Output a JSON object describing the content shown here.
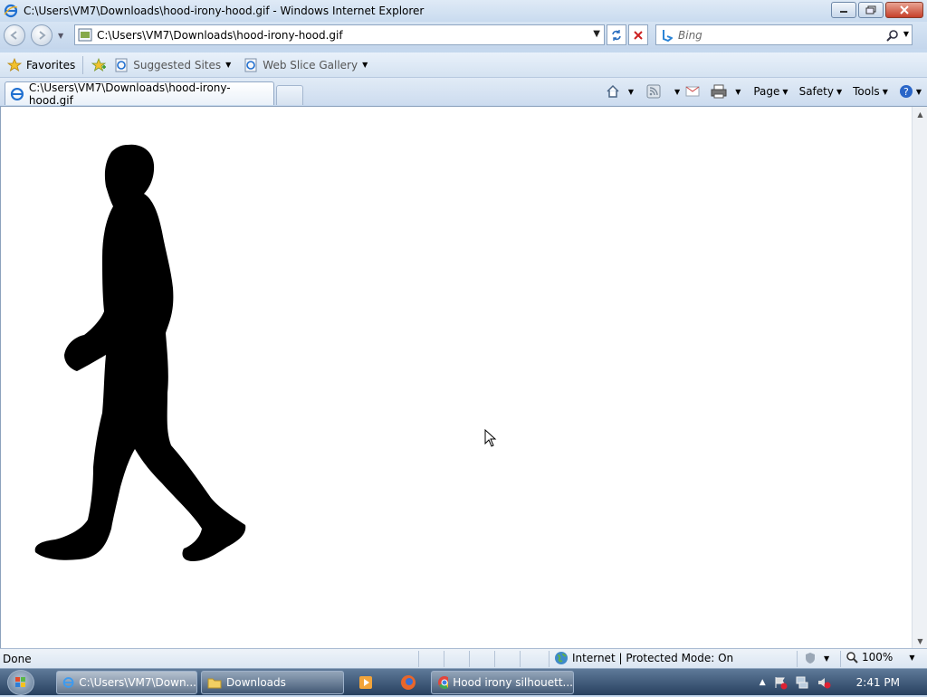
{
  "window": {
    "title": "C:\\Users\\VM7\\Downloads\\hood-irony-hood.gif - Windows Internet Explorer"
  },
  "nav": {
    "address": "C:\\Users\\VM7\\Downloads\\hood-irony-hood.gif",
    "search_placeholder": "Bing"
  },
  "favorites": {
    "favorites_label": "Favorites",
    "suggested_label": "Suggested Sites",
    "webslice_label": "Web Slice Gallery"
  },
  "tab": {
    "label": "C:\\Users\\VM7\\Downloads\\hood-irony-hood.gif"
  },
  "commands": {
    "page_label": "Page",
    "safety_label": "Safety",
    "tools_label": "Tools"
  },
  "status": {
    "text": "Done",
    "zone": "Internet | Protected Mode: On",
    "zoom": "100%"
  },
  "taskbar": {
    "items": [
      {
        "label": "C:\\Users\\VM7\\Down..."
      },
      {
        "label": "Downloads"
      },
      {
        "label": "Hood irony silhouett..."
      }
    ],
    "clock": "2:41 PM"
  },
  "image": {
    "subject": "walking-person-silhouette"
  }
}
